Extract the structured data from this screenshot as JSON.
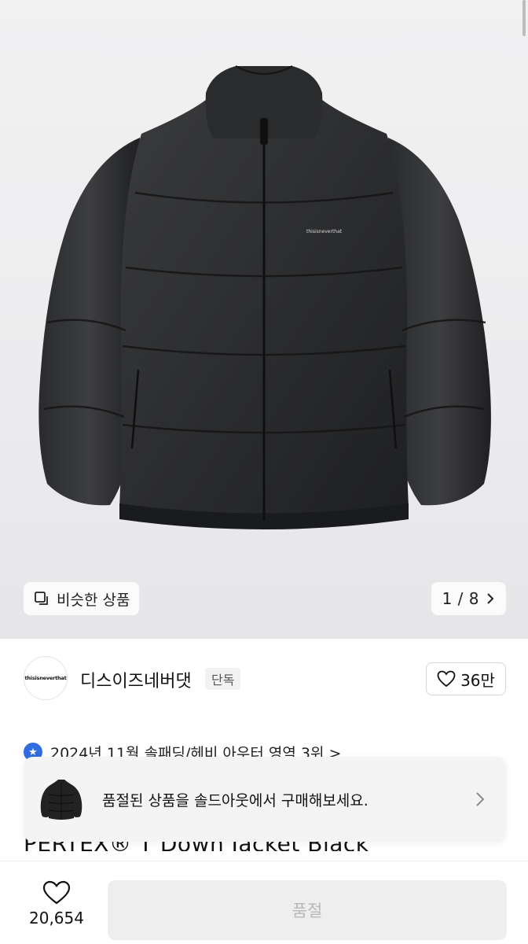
{
  "hero": {
    "similar_button_label": "비슷한 상품",
    "pager_text": "1 / 8",
    "jacket_logo_text": "thisisneverthat"
  },
  "brand": {
    "logo_text": "thisisneverthat",
    "name": "디스이즈네버댓",
    "tag": "단독",
    "like_count": "36만"
  },
  "notice": {
    "badge_icon": "star-icon",
    "text": "2024년 11월 솔패딩/헤비 아우터 영역 3위 >"
  },
  "product_title_peek": "PERTEX® T Down Jacket Black",
  "soldout_banner": {
    "text": "품절된 상품을 솔드아웃에서 구매해보세요."
  },
  "bottom_bar": {
    "wish_count": "20,654",
    "buy_label": "품절"
  },
  "colors": {
    "accent_blue": "#2f6de1",
    "disabled_bg": "#eeeeee",
    "disabled_text": "#b8b8b8"
  }
}
